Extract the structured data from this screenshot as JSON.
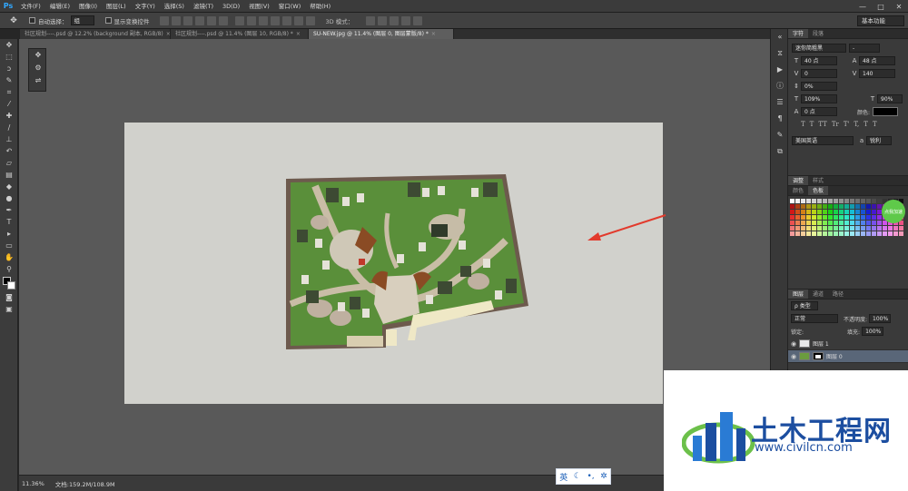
{
  "app": {
    "logo": "Ps"
  },
  "menu": [
    "文件(F)",
    "编辑(E)",
    "图像(I)",
    "图层(L)",
    "文字(Y)",
    "选择(S)",
    "滤镜(T)",
    "3D(D)",
    "视图(V)",
    "窗口(W)",
    "帮助(H)"
  ],
  "window_controls": [
    "—",
    "□",
    "✕"
  ],
  "options": {
    "auto_select_label": "自动选择：",
    "auto_select_value": "组",
    "show_transform_label": "显示变换控件",
    "mode_3d_label": "3D 模式：",
    "workspace": "基本功能"
  },
  "tabs": [
    {
      "label": "社区规划----.psd @ 12.2% (background 副本, RGB/8)",
      "close": "×",
      "active": false
    },
    {
      "label": "社区规划----.psd @ 11.4% (图层 10, RGB/8) *",
      "close": "×",
      "active": false
    },
    {
      "label": "SU-NEW.jpg @ 11.4% (图层 0, 图层蒙版/8) *",
      "close": "×",
      "active": true
    }
  ],
  "status": {
    "zoom": "11.36%",
    "doc": "文档:159.2M/108.9M"
  },
  "character_panel": {
    "tabs": [
      "字符",
      "段落"
    ],
    "font_family": "迷你简粗黑",
    "font_style": "-",
    "font_size": "40 点",
    "leading": "48 点",
    "kerning": "0",
    "tracking": "140",
    "baseline_scale": "0%",
    "vertical_scale": "109%",
    "horizontal_scale": "90%",
    "baseline_shift": "0 点",
    "color_label": "颜色:",
    "language": "美国英语",
    "antialias": "锐利",
    "text_style_glyphs": [
      "T",
      "T",
      "TT",
      "Tr",
      "T'",
      "T,",
      "T",
      "T"
    ]
  },
  "swatch_panel": {
    "tabs": [
      "调整",
      "样式"
    ],
    "sub_tabs": [
      "颜色",
      "色板"
    ],
    "badge": "点我加速"
  },
  "layers_panel": {
    "tabs": [
      "图层",
      "通道",
      "路径"
    ],
    "filter_label": "ρ 类型",
    "blend_mode": "正常",
    "opacity_label": "不透明度:",
    "opacity": "100%",
    "lock_label": "锁定:",
    "fill_label": "填充:",
    "fill": "100%",
    "layers": [
      {
        "name": "图层 1",
        "visible": true,
        "selected": false
      },
      {
        "name": "图层 0",
        "visible": true,
        "selected": true
      }
    ]
  },
  "ime": {
    "lang": "英",
    "moon": "☾",
    "dot": "•,",
    "gear": "✲"
  },
  "watermark": {
    "title": "土木工程网",
    "url": "www.civilcn.com"
  }
}
